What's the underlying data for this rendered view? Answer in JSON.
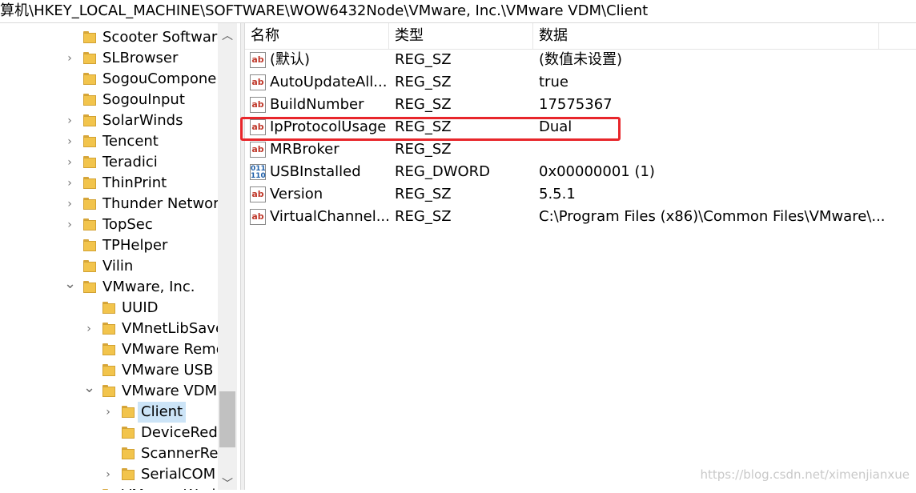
{
  "address_path": "算机\\HKEY_LOCAL_MACHINE\\SOFTWARE\\WOW6432Node\\VMware, Inc.\\VMware VDM\\Client",
  "tree_items": [
    {
      "label": "Scooter Software",
      "level": 0,
      "expander": "none"
    },
    {
      "label": "SLBrowser",
      "level": 0,
      "expander": "collapsed"
    },
    {
      "label": "SogouComponer",
      "level": 0,
      "expander": "none"
    },
    {
      "label": "SogouInput",
      "level": 0,
      "expander": "none"
    },
    {
      "label": "SolarWinds",
      "level": 0,
      "expander": "collapsed"
    },
    {
      "label": "Tencent",
      "level": 0,
      "expander": "collapsed"
    },
    {
      "label": "Teradici",
      "level": 0,
      "expander": "collapsed"
    },
    {
      "label": "ThinPrint",
      "level": 0,
      "expander": "collapsed"
    },
    {
      "label": "Thunder Networ",
      "level": 0,
      "expander": "collapsed"
    },
    {
      "label": "TopSec",
      "level": 0,
      "expander": "collapsed"
    },
    {
      "label": "TPHelper",
      "level": 0,
      "expander": "none"
    },
    {
      "label": "Vilin",
      "level": 0,
      "expander": "none"
    },
    {
      "label": "VMware, Inc.",
      "level": 0,
      "expander": "expanded"
    },
    {
      "label": "UUID",
      "level": 1,
      "expander": "none"
    },
    {
      "label": "VMnetLibSave",
      "level": 1,
      "expander": "collapsed"
    },
    {
      "label": "VMware Remo",
      "level": 1,
      "expander": "none"
    },
    {
      "label": "VMware USB",
      "level": 1,
      "expander": "none"
    },
    {
      "label": "VMware VDM",
      "level": 1,
      "expander": "expanded"
    },
    {
      "label": "Client",
      "level": 2,
      "expander": "collapsed",
      "selected": true
    },
    {
      "label": "DeviceRedi",
      "level": 2,
      "expander": "none"
    },
    {
      "label": "ScannerRed",
      "level": 2,
      "expander": "none"
    },
    {
      "label": "SerialCOM",
      "level": 2,
      "expander": "collapsed"
    },
    {
      "label": "VMware Work",
      "level": 1,
      "expander": "collapsed"
    }
  ],
  "columns": {
    "name": "名称",
    "type": "类型",
    "data": "数据"
  },
  "values": [
    {
      "name": "(默认)",
      "type": "REG_SZ",
      "data": "(数值未设置)",
      "icon": "string-value-icon"
    },
    {
      "name": "AutoUpdateAll...",
      "type": "REG_SZ",
      "data": "true",
      "icon": "string-value-icon"
    },
    {
      "name": "BuildNumber",
      "type": "REG_SZ",
      "data": "17575367",
      "icon": "string-value-icon"
    },
    {
      "name": "IpProtocolUsage",
      "type": "REG_SZ",
      "data": "Dual",
      "icon": "string-value-icon",
      "highlighted": true
    },
    {
      "name": "MRBroker",
      "type": "REG_SZ",
      "data": "",
      "icon": "string-value-icon"
    },
    {
      "name": "USBInstalled",
      "type": "REG_DWORD",
      "data": "0x00000001 (1)",
      "icon": "dword-value-icon"
    },
    {
      "name": "Version",
      "type": "REG_SZ",
      "data": "5.5.1",
      "icon": "string-value-icon"
    },
    {
      "name": "VirtualChannel...",
      "type": "REG_SZ",
      "data": "C:\\Program Files (x86)\\Common Files\\VMware\\...",
      "icon": "string-value-icon"
    }
  ],
  "watermark": "https://blog.csdn.net/ximenjianxue",
  "colors": {
    "highlight_border": "#e8262b",
    "selection": "#cce4f7",
    "folder": "#f2c44c"
  }
}
